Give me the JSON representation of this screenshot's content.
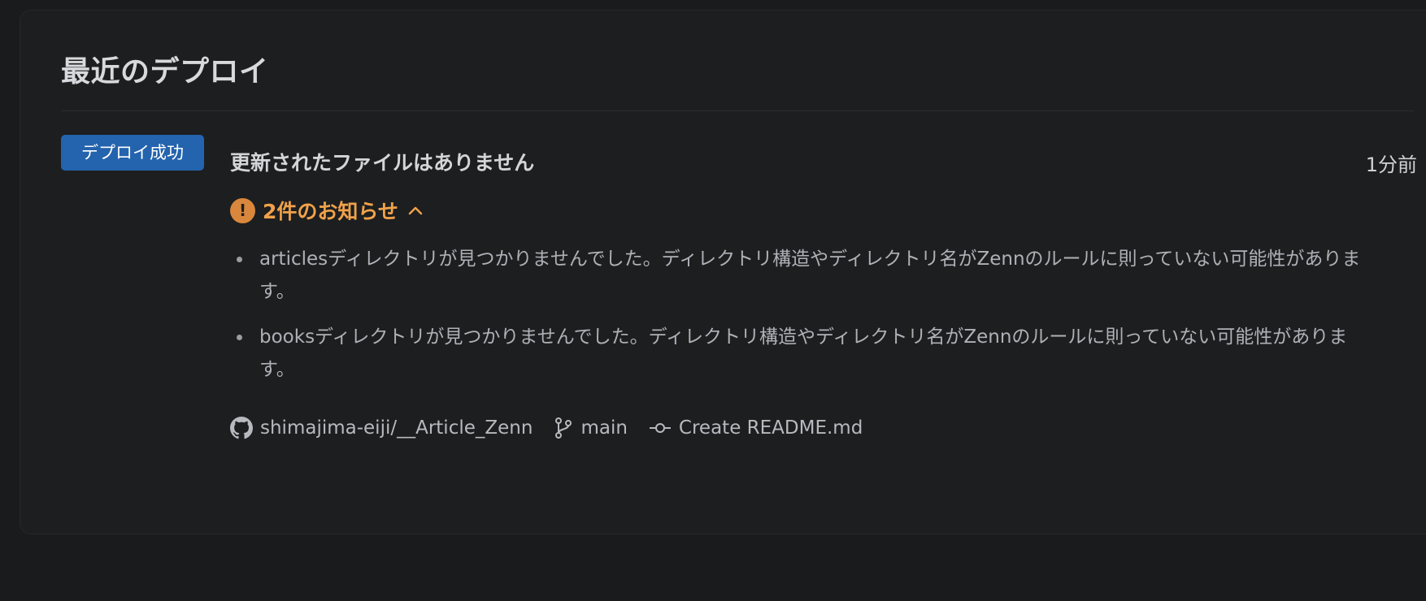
{
  "section": {
    "title": "最近のデプロイ"
  },
  "deploy": {
    "status_badge": "デプロイ成功",
    "message": "更新されたファイルはありません",
    "time": "1分前",
    "notice_toggle": {
      "label": "2件のお知らせ",
      "icon": "warning-circle-icon",
      "expanded": true
    },
    "notices": [
      "articlesディレクトリが見つかりませんでした。ディレクトリ構造やディレクトリ名がZennのルールに則っていない可能性があります。",
      "booksディレクトリが見つかりませんでした。ディレクトリ構造やディレクトリ名がZennのルールに則っていない可能性があります。"
    ],
    "meta": {
      "repository": "shimajima-eiji/__Article_Zenn",
      "branch": "main",
      "commit": "Create README.md"
    }
  },
  "colors": {
    "background": "#1a1b1d",
    "card": "#1d1e20",
    "badge": "#2463ad",
    "warning": "#f0a24a"
  }
}
